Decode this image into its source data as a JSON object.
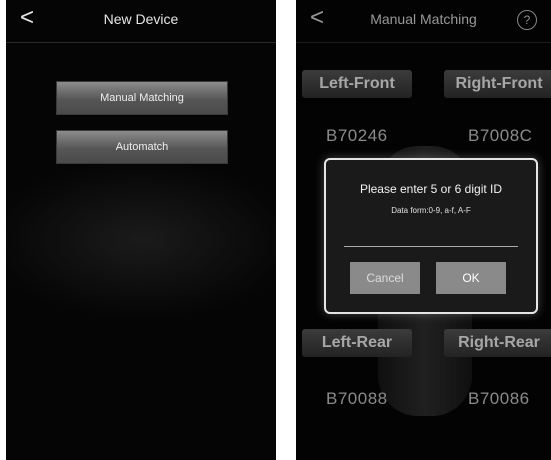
{
  "left_screen": {
    "back_glyph": "<",
    "title": "New Device",
    "buttons": [
      "Manual Matching",
      "Automatch"
    ]
  },
  "right_screen": {
    "back_glyph": "<",
    "title": "Manual Matching",
    "help_glyph": "?",
    "tires": {
      "left_front": {
        "label": "Left-Front",
        "id": "B70246"
      },
      "right_front": {
        "label": "Right-Front",
        "id": "B7008C"
      },
      "left_rear": {
        "label": "Left-Rear",
        "id": "B70088"
      },
      "right_rear": {
        "label": "Right-Rear",
        "id": "B70086"
      }
    },
    "dialog": {
      "title": "Please enter 5 or 6 digit ID",
      "subtitle": "Data form:0-9, a-f, A-F",
      "input_value": "",
      "cancel_label": "Cancel",
      "ok_label": "OK"
    }
  },
  "colors": {
    "background": "#050505",
    "button_gray": "#6e6e6e",
    "dialog_border": "#e6e6e6",
    "text": "#ffffff"
  }
}
